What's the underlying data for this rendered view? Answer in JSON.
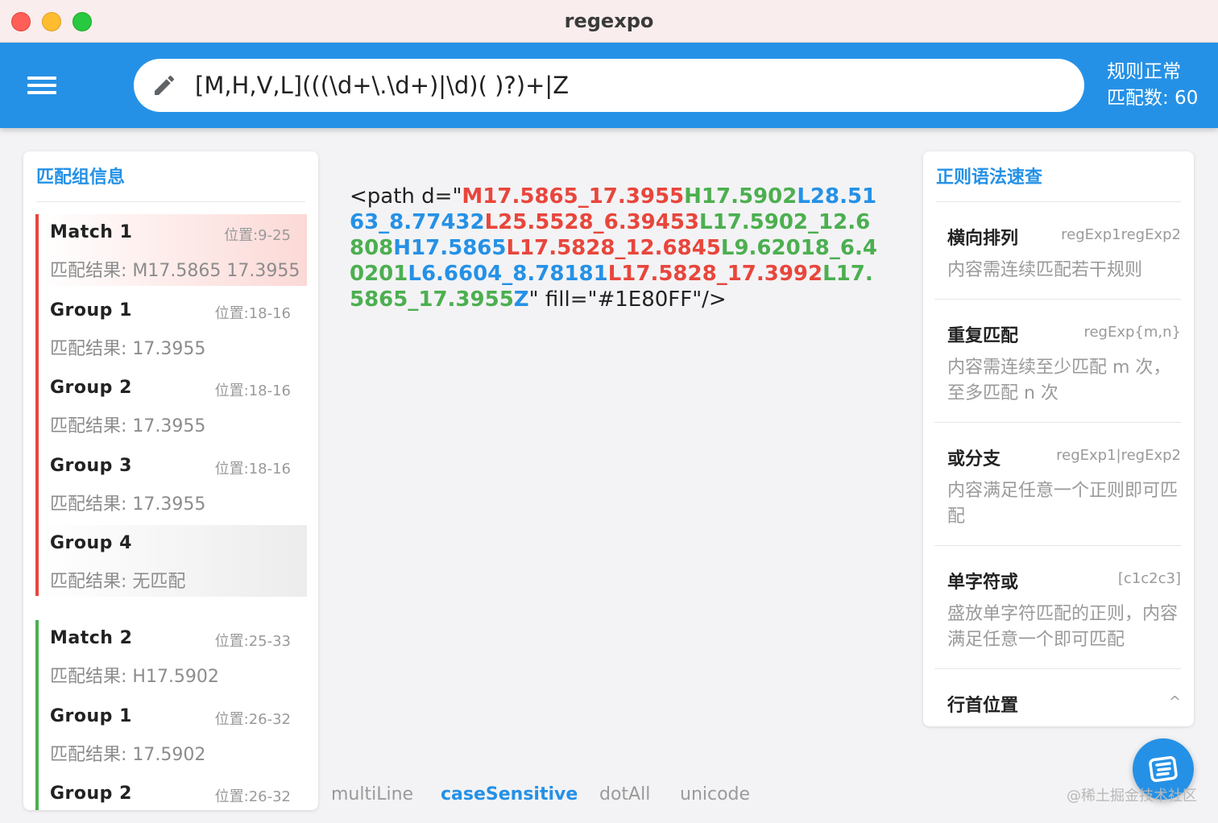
{
  "window": {
    "title": "regexpo"
  },
  "appbar": {
    "regex": "[M,H,V,L](((\\d+\\.\\d+)|\\d)( )?)+|Z",
    "status_line1": "规则正常",
    "status_line2": "匹配数: 60"
  },
  "left_panel": {
    "title": "匹配组信息",
    "blocks": [
      {
        "color": "#e8463c",
        "rows": [
          {
            "title": "Match  1",
            "pos": "位置:9-25",
            "result": "匹配结果: M17.5865 17.3955",
            "highlight": "red"
          },
          {
            "title": "Group  1",
            "pos": "位置:18-16",
            "result": "匹配结果: 17.3955",
            "highlight": "none"
          },
          {
            "title": "Group  2",
            "pos": "位置:18-16",
            "result": "匹配结果: 17.3955",
            "highlight": "none"
          },
          {
            "title": "Group  3",
            "pos": "位置:18-16",
            "result": "匹配结果: 17.3955",
            "highlight": "none"
          },
          {
            "title": "Group  4",
            "pos": "",
            "result": "匹配结果: 无匹配",
            "highlight": "grey"
          }
        ]
      },
      {
        "color": "#4caf50",
        "rows": [
          {
            "title": "Match  2",
            "pos": "位置:25-33",
            "result": "匹配结果: H17.5902",
            "highlight": "none"
          },
          {
            "title": "Group  1",
            "pos": "位置:26-32",
            "result": "匹配结果: 17.5902",
            "highlight": "none"
          },
          {
            "title": "Group  2",
            "pos": "位置:26-32",
            "result": "",
            "highlight": "none"
          }
        ]
      }
    ]
  },
  "center": {
    "segments": [
      {
        "text": "<path d=\"",
        "style": "plain"
      },
      {
        "text": "M17.5865_17.3955",
        "style": "red"
      },
      {
        "text": "H17.5902",
        "style": "green"
      },
      {
        "text": "L28.5163_8.77432",
        "style": "blue"
      },
      {
        "text": "L25.5528_6.39453",
        "style": "red"
      },
      {
        "text": "L17.5902_12.6808",
        "style": "green"
      },
      {
        "text": "H17.5865",
        "style": "blue"
      },
      {
        "text": "L17.5828_12.6845",
        "style": "red"
      },
      {
        "text": "L9.62018_6.40201",
        "style": "green"
      },
      {
        "text": "L6.6604_8.78181",
        "style": "blue"
      },
      {
        "text": "L17.5828_17.3992",
        "style": "red"
      },
      {
        "text": "L17.5865_17.3955",
        "style": "green"
      },
      {
        "text": "Z",
        "style": "blue"
      },
      {
        "text": "\" fill=\"#1E80FF\"/>",
        "style": "plain"
      }
    ]
  },
  "flags": [
    {
      "label": "multiLine",
      "active": false
    },
    {
      "label": "caseSensitive",
      "active": true
    },
    {
      "label": "dotAll",
      "active": false
    },
    {
      "label": "unicode",
      "active": false
    }
  ],
  "right_panel": {
    "title": "正则语法速查",
    "items": [
      {
        "title": "横向排列",
        "code": "regExp1regExp2",
        "desc": "内容需连续匹配若干规则"
      },
      {
        "title": "重复匹配",
        "code": "regExp{m,n}",
        "desc": "内容需连续至少匹配 m 次，至多匹配 n 次"
      },
      {
        "title": "或分支",
        "code": "regExp1|regExp2",
        "desc": "内容满足任意一个正则即可匹配"
      },
      {
        "title": "单字符或",
        "code": "[c1c2c3]",
        "desc": "盛放单字符匹配的正则，内容满足任意一个即可匹配"
      },
      {
        "title": "行首位置",
        "code": "^",
        "desc": ""
      }
    ]
  },
  "watermark": "@稀土掘金技术社区",
  "colors": {
    "accent": "#2591e6",
    "match_red": "#e8463c",
    "match_green": "#4caf50"
  },
  "icons": {
    "menu": "menu-icon",
    "edit": "pencil-icon",
    "fab": "list-icon"
  }
}
